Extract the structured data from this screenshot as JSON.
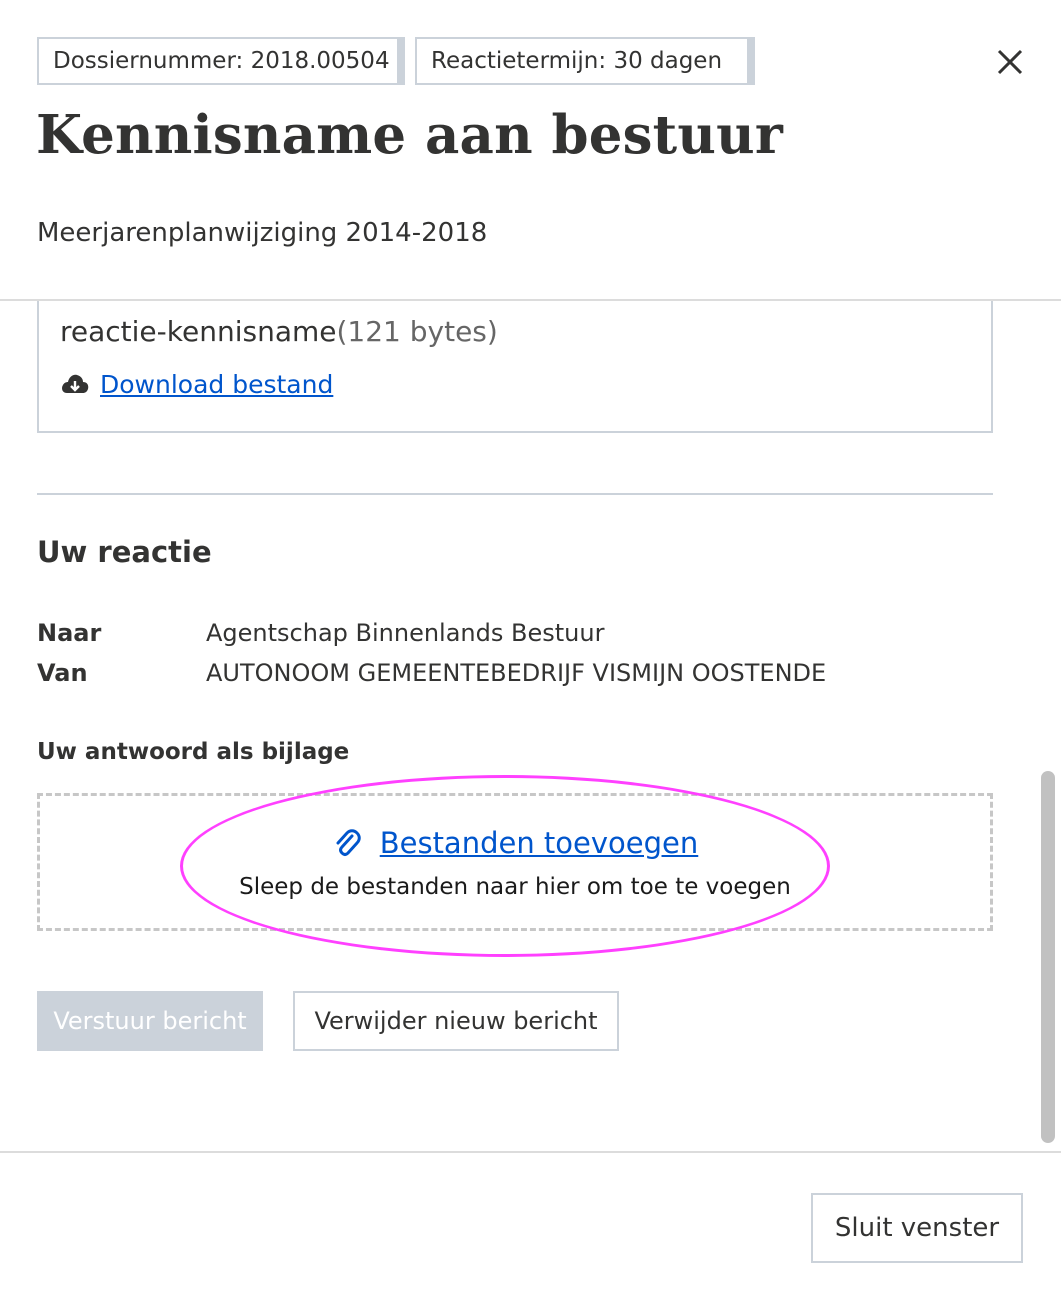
{
  "header": {
    "dossier_pill": "Dossiernummer: 2018.00504",
    "deadline_pill": "Reactietermijn: 30 dagen",
    "title": "Kennisname aan bestuur",
    "subtitle": "Meerjarenplanwijziging 2014-2018",
    "close_icon": "close-icon"
  },
  "file": {
    "name": "reactie-kennisname",
    "size": "(121 bytes)",
    "download_label": "Download bestand",
    "download_icon": "cloud-download-icon"
  },
  "reaction": {
    "title": "Uw reactie",
    "to_label": "Naar",
    "to_value": "Agentschap Binnenlands Bestuur",
    "from_label": "Van",
    "from_value": "AUTONOOM GEMEENTEBEDRIJF VISMIJN OOSTENDE",
    "attachment_label": "Uw antwoord als bijlage",
    "add_files_label": "Bestanden toevoegen",
    "add_files_icon": "paperclip-icon",
    "drop_hint": "Sleep de bestanden naar hier om toe te voegen",
    "send_label": "Verstuur bericht",
    "delete_label": "Verwijder nieuw bericht"
  },
  "footer": {
    "close_label": "Sluit venster"
  },
  "colors": {
    "link": "#0055cc",
    "text": "#333332",
    "border": "#cbd2da",
    "highlight": "#ff40ff",
    "disabled_button": "#cbd2da"
  }
}
